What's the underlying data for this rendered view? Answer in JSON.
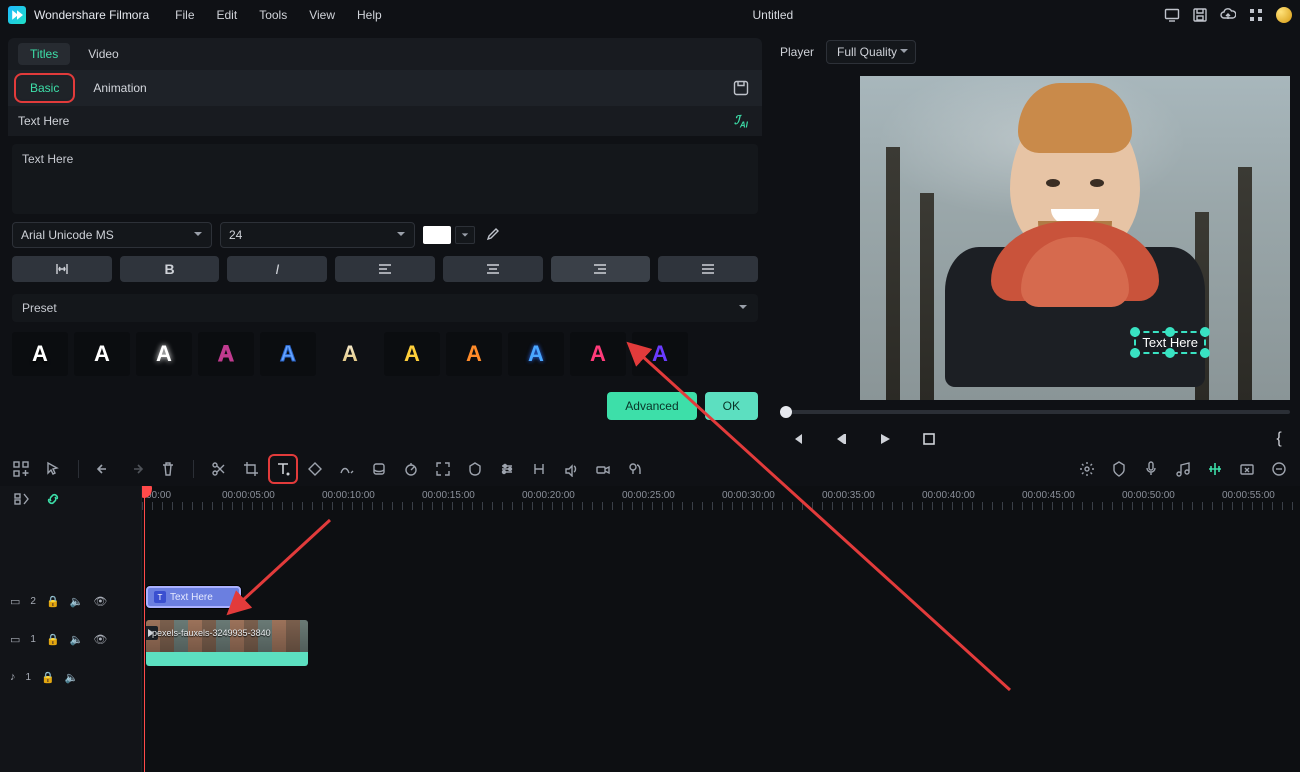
{
  "app": {
    "name": "Wondershare Filmora",
    "document_title": "Untitled"
  },
  "menus": [
    "File",
    "Edit",
    "Tools",
    "View",
    "Help"
  ],
  "titles_panel": {
    "tabs": [
      "Titles",
      "Video"
    ],
    "active_tab": "Titles",
    "subtabs": [
      "Basic",
      "Animation"
    ],
    "active_subtab": "Basic",
    "magic_label": "AI",
    "title_row": "Text Here",
    "text_value": "Text Here",
    "font": "Arial Unicode MS",
    "font_size": "24",
    "color_hex": "#FFFFFF",
    "preset_label": "Preset",
    "buttons": {
      "advanced": "Advanced",
      "ok": "OK"
    }
  },
  "player": {
    "label": "Player",
    "quality": "Full Quality",
    "overlay_text": "Text Here"
  },
  "timeline": {
    "ruler": [
      "00:00",
      "00:00:05:00",
      "00:00:10:00",
      "00:00:15:00",
      "00:00:20:00",
      "00:00:25:00",
      "00:00:30:00",
      "00:00:35:00",
      "00:00:40:00",
      "00:00:45:00",
      "00:00:50:00",
      "00:00:55:00"
    ],
    "tracks": {
      "title": {
        "idx": "2",
        "clip_label": "Text Here"
      },
      "video": {
        "idx": "1",
        "clip_label": "pexels-fauxels-3249935-3840"
      },
      "audio": {
        "idx": "1"
      }
    }
  }
}
